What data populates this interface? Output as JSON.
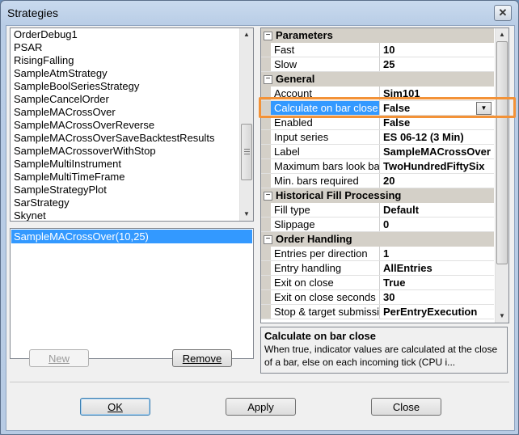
{
  "window": {
    "title": "Strategies",
    "close_label": "✕"
  },
  "strategies": {
    "items": [
      "OrderDebug1",
      "PSAR",
      "RisingFalling",
      "SampleAtmStrategy",
      "SampleBoolSeriesStrategy",
      "SampleCancelOrder",
      "SampleMACrossOver",
      "SampleMACrossOverReverse",
      "SampleMACrossOverSaveBacktestResults",
      "SampleMACrossoverWithStop",
      "SampleMultiInstrument",
      "SampleMultiTimeFrame",
      "SampleStrategyPlot",
      "SarStrategy",
      "Skynet"
    ],
    "scroll_up": "▲",
    "scroll_down": "▼"
  },
  "applied": {
    "items": [
      "SampleMACrossOver(10,25)"
    ]
  },
  "buttons": {
    "new": "New",
    "remove": "Remove",
    "ok": "OK",
    "apply": "Apply",
    "close": "Close"
  },
  "grid": {
    "scroll_up": "▲",
    "scroll_down": "▼",
    "categories": [
      {
        "name": "Parameters",
        "toggle": "−",
        "rows": [
          {
            "name": "Fast",
            "value": "10"
          },
          {
            "name": "Slow",
            "value": "25"
          }
        ]
      },
      {
        "name": "General",
        "toggle": "−",
        "rows": [
          {
            "name": "Account",
            "value": "Sim101"
          },
          {
            "name": "Calculate on bar close",
            "value": "False"
          },
          {
            "name": "Enabled",
            "value": "False"
          },
          {
            "name": "Input series",
            "value": "ES 06-12 (3 Min)"
          },
          {
            "name": "Label",
            "value": "SampleMACrossOver"
          },
          {
            "name": "Maximum bars look back",
            "value": "TwoHundredFiftySix"
          },
          {
            "name": "Min. bars required",
            "value": "20"
          }
        ]
      },
      {
        "name": "Historical Fill Processing",
        "toggle": "−",
        "rows": [
          {
            "name": "Fill type",
            "value": "Default"
          },
          {
            "name": "Slippage",
            "value": "0"
          }
        ]
      },
      {
        "name": "Order Handling",
        "toggle": "−",
        "rows": [
          {
            "name": "Entries per direction",
            "value": "1"
          },
          {
            "name": "Entry handling",
            "value": "AllEntries"
          },
          {
            "name": "Exit on close",
            "value": "True"
          },
          {
            "name": "Exit on close seconds",
            "value": "30"
          },
          {
            "name": "Stop & target submission",
            "value": "PerEntryExecution"
          }
        ]
      }
    ],
    "dropdown_glyph": "▼"
  },
  "description": {
    "title": "Calculate on bar close",
    "text": "When true, indicator values are calculated at the close of a bar, else on each incoming tick (CPU i..."
  },
  "colors": {
    "selection": "#3399ff",
    "highlight": "#f39237"
  }
}
